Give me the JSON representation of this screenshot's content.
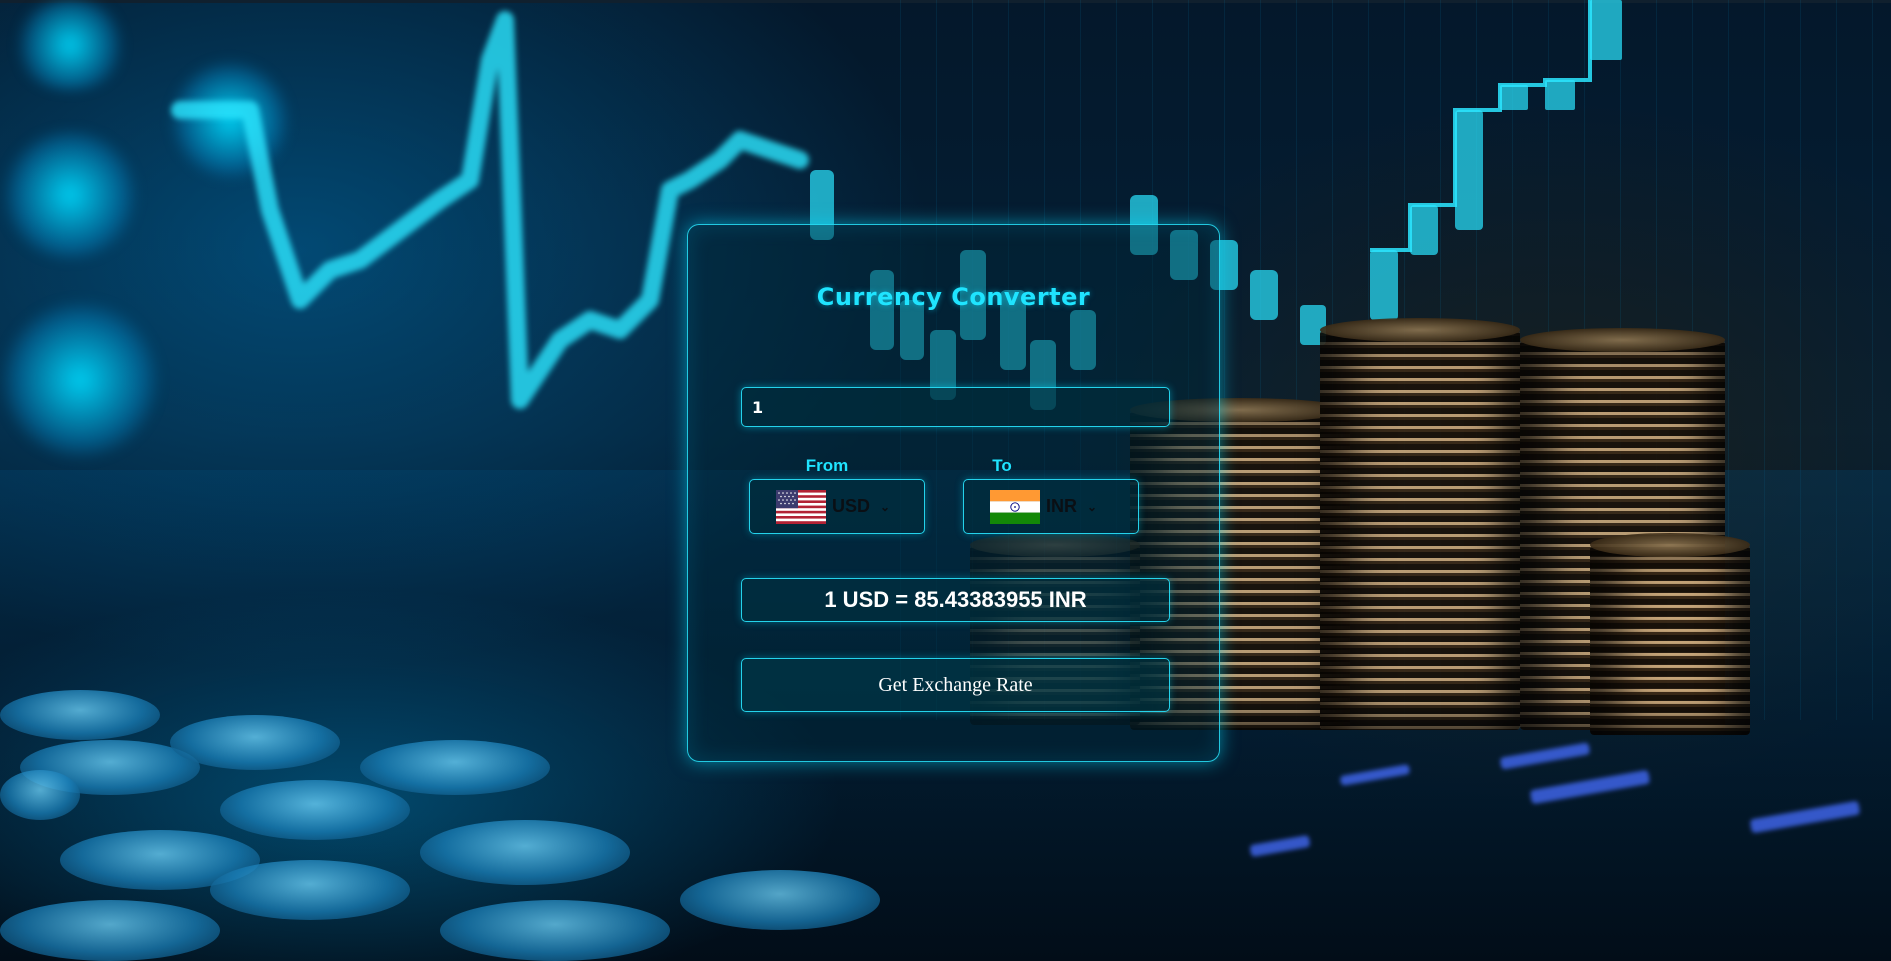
{
  "app": {
    "title": "Currency Converter"
  },
  "amount": {
    "value": "1"
  },
  "from": {
    "label": "From",
    "currency": "USD",
    "flag_icon": "us-flag-icon"
  },
  "to": {
    "label": "To",
    "currency": "INR",
    "flag_icon": "india-flag-icon"
  },
  "result": {
    "text": "1 USD = 85.43383955 INR"
  },
  "actions": {
    "get_rate_label": "Get Exchange Rate"
  },
  "colors": {
    "accent": "#1fe4ff",
    "text": "#ffffff"
  }
}
